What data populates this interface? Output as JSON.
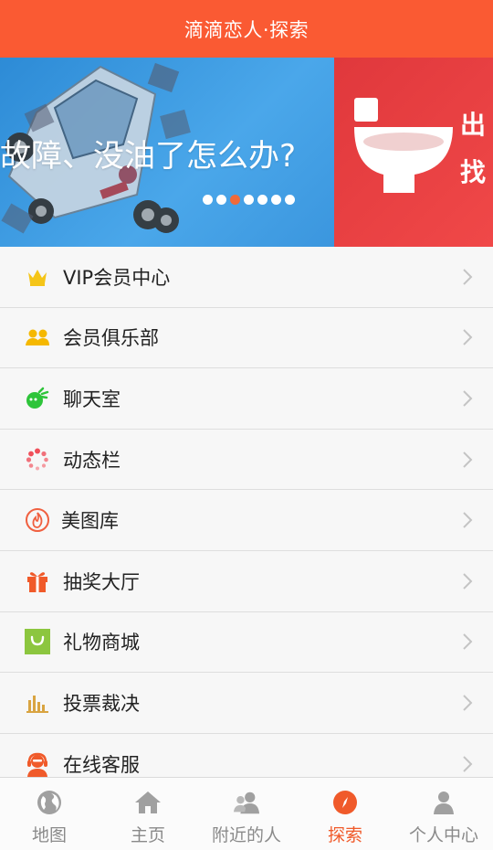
{
  "header": {
    "title": "滴滴恋人·探索"
  },
  "banner": {
    "slide1_text": "故障、没油了怎么办?",
    "slide2_line1": "出",
    "slide2_line2": "找",
    "dot_count": 7,
    "active_dot": 2
  },
  "menu": {
    "items": [
      {
        "label": "VIP会员中心",
        "icon": "crown-icon"
      },
      {
        "label": "会员俱乐部",
        "icon": "group-icon"
      },
      {
        "label": "聊天室",
        "icon": "chat-icon"
      },
      {
        "label": "动态栏",
        "icon": "spinner-icon"
      },
      {
        "label": "美图库",
        "icon": "flame-icon"
      },
      {
        "label": "抽奖大厅",
        "icon": "gift-icon"
      },
      {
        "label": "礼物商城",
        "icon": "shopping-bag-icon"
      },
      {
        "label": "投票裁决",
        "icon": "bar-chart-icon"
      },
      {
        "label": "在线客服",
        "icon": "headset-icon"
      }
    ]
  },
  "tabbar": {
    "tabs": [
      {
        "label": "地图",
        "icon": "globe-icon"
      },
      {
        "label": "主页",
        "icon": "home-icon"
      },
      {
        "label": "附近的人",
        "icon": "people-icon"
      },
      {
        "label": "探索",
        "icon": "compass-icon",
        "active": true
      },
      {
        "label": "个人中心",
        "icon": "user-icon"
      }
    ]
  },
  "colors": {
    "header_bg": "#fa5a33",
    "active_tab": "#f05a2a",
    "banner_blue": "#3b96de",
    "banner_red": "#e0383c"
  }
}
